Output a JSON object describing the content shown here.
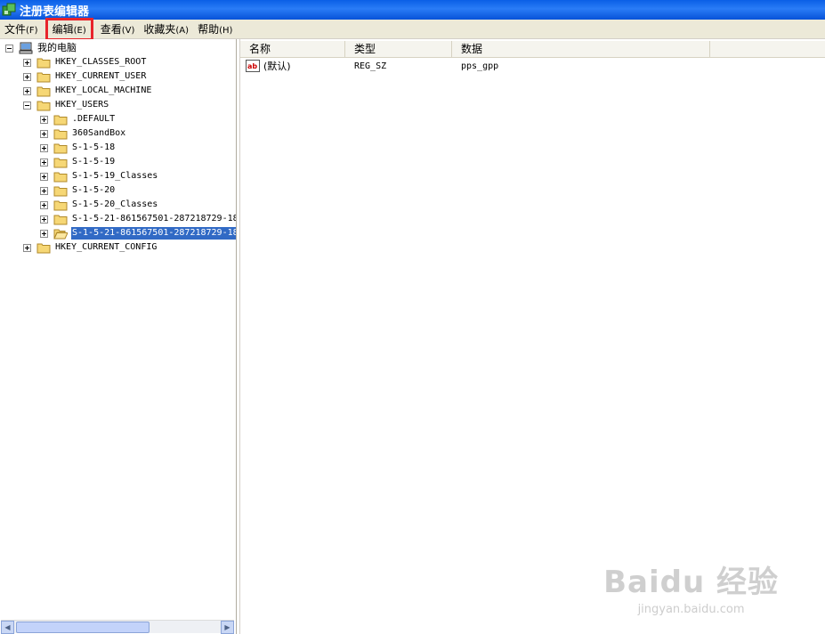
{
  "window": {
    "title": "注册表编辑器"
  },
  "menu": [
    {
      "label": "文件",
      "accel": "(F)"
    },
    {
      "label": "编辑",
      "accel": "(E)"
    },
    {
      "label": "查看",
      "accel": "(V)"
    },
    {
      "label": "收藏夹",
      "accel": "(A)"
    },
    {
      "label": "帮助",
      "accel": "(H)"
    }
  ],
  "tree": {
    "root": "我的电脑",
    "nodes": [
      "HKEY_CLASSES_ROOT",
      "HKEY_CURRENT_USER",
      "HKEY_LOCAL_MACHINE",
      "HKEY_USERS",
      ".DEFAULT",
      "360SandBox",
      "S-1-5-18",
      "S-1-5-19",
      "S-1-5-19_Classes",
      "S-1-5-20",
      "S-1-5-20_Classes",
      "S-1-5-21-861567501-287218729-18",
      "S-1-5-21-861567501-287218729-18",
      "HKEY_CURRENT_CONFIG"
    ]
  },
  "columns": {
    "name": "名称",
    "type": "类型",
    "data": "数据"
  },
  "values": [
    {
      "name": "(默认)",
      "type": "REG_SZ",
      "data": "pps_gpp"
    }
  ],
  "watermark": {
    "logo": "Baidu 经验",
    "url": "jingyan.baidu.com"
  },
  "colors": {
    "titlebar": "#0a5fe6",
    "selection": "#316ac5",
    "highlight_box": "#e8242b"
  }
}
